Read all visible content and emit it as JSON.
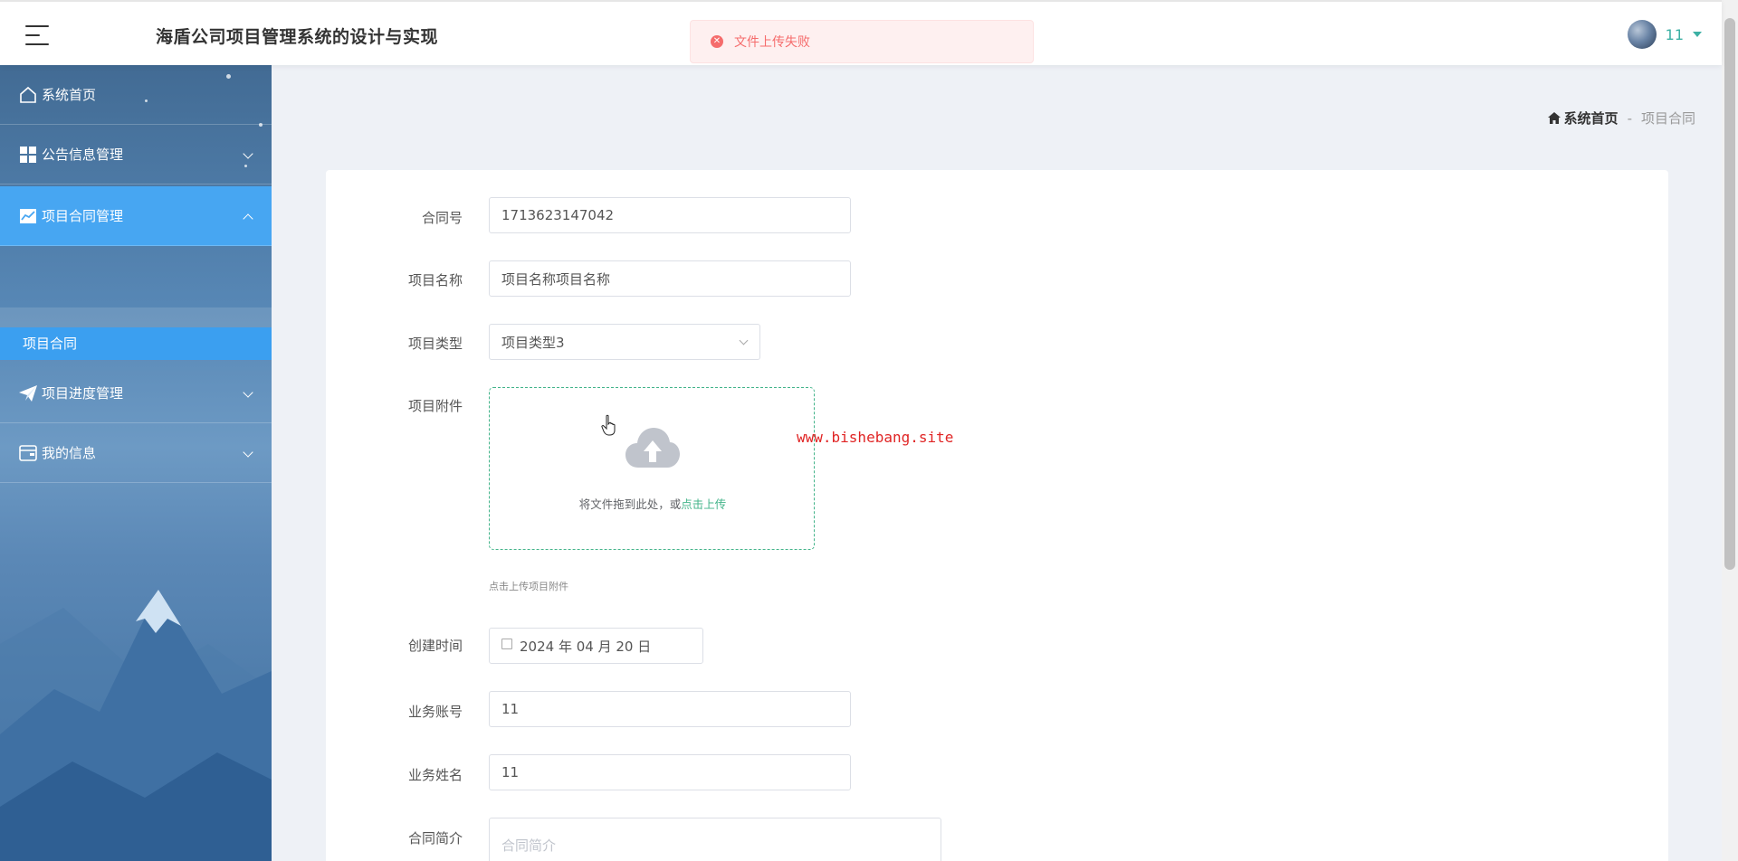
{
  "header": {
    "title": "海盾公司项目管理系统的设计与实现",
    "user_name": "11"
  },
  "toast": {
    "message": "文件上传失败",
    "icon": "error-circle-icon"
  },
  "sidebar": {
    "items": [
      {
        "label": "系统首页",
        "icon": "home-icon"
      },
      {
        "label": "公告信息管理",
        "icon": "grid-icon"
      },
      {
        "label": "项目合同管理",
        "icon": "chart-icon"
      },
      {
        "label": "项目进度管理",
        "icon": "paper-plane-icon"
      },
      {
        "label": "我的信息",
        "icon": "wallet-icon"
      }
    ],
    "sub_items": [
      {
        "label": "项目合同"
      }
    ]
  },
  "breadcrumb": {
    "home": "系统首页",
    "separator": "-",
    "current": "项目合同"
  },
  "form": {
    "contract_no_label": "合同号",
    "contract_no_value": "1713623147042",
    "project_name_label": "项目名称",
    "project_name_value": "项目名称项目名称",
    "project_type_label": "项目类型",
    "project_type_value": "项目类型3",
    "attachment_label": "项目附件",
    "upload_text": "将文件拖到此处，或",
    "upload_link": "点击上传",
    "upload_tip": "点击上传项目附件",
    "created_label": "创建时间",
    "created_value": "2024 年 04 月 20 日",
    "account_label": "业务账号",
    "account_value": "11",
    "name_label": "业务姓名",
    "name_value": "11",
    "intro_label": "合同简介",
    "intro_placeholder": "合同简介"
  },
  "watermark": "www.bishebang.site",
  "colors": {
    "accent_green": "#43b48a",
    "sidebar_active": "#47a6f2",
    "error": "#f56c6c"
  }
}
